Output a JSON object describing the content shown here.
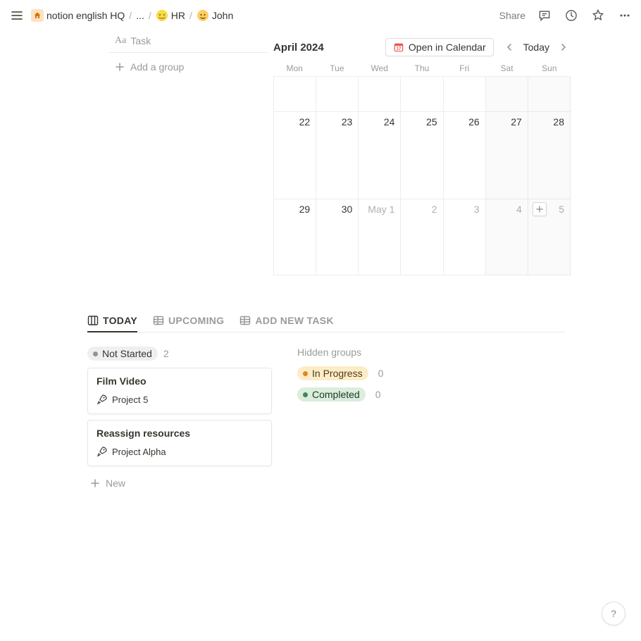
{
  "topbar": {
    "breadcrumb": {
      "root": "notion english HQ",
      "ellipsis": "...",
      "hr": "HR",
      "person": "John"
    },
    "share": "Share"
  },
  "left": {
    "task_prefix": "Aa",
    "task_label": "Task",
    "add_group": "Add a group"
  },
  "calendar": {
    "title": "April 2024",
    "open_label": "Open in Calendar",
    "today": "Today",
    "dow": [
      "Mon",
      "Tue",
      "Wed",
      "Thu",
      "Fri",
      "Sat",
      "Sun"
    ],
    "row2": [
      "22",
      "23",
      "24",
      "25",
      "26",
      "27",
      "28"
    ],
    "row3": [
      "29",
      "30",
      "May 1",
      "2",
      "3",
      "4",
      "5"
    ]
  },
  "tabs": {
    "today": "TODAY",
    "upcoming": "UPCOMING",
    "addnew": "ADD NEW TASK"
  },
  "board": {
    "not_started": {
      "label": "Not Started",
      "count": "2"
    },
    "cards": [
      {
        "title": "Film Video",
        "project": "Project 5"
      },
      {
        "title": "Reassign resources",
        "project": "Project Alpha"
      }
    ],
    "new_label": "New",
    "hidden_label": "Hidden groups",
    "in_progress": {
      "label": "In Progress",
      "count": "0"
    },
    "completed": {
      "label": "Completed",
      "count": "0"
    }
  },
  "help": "?"
}
